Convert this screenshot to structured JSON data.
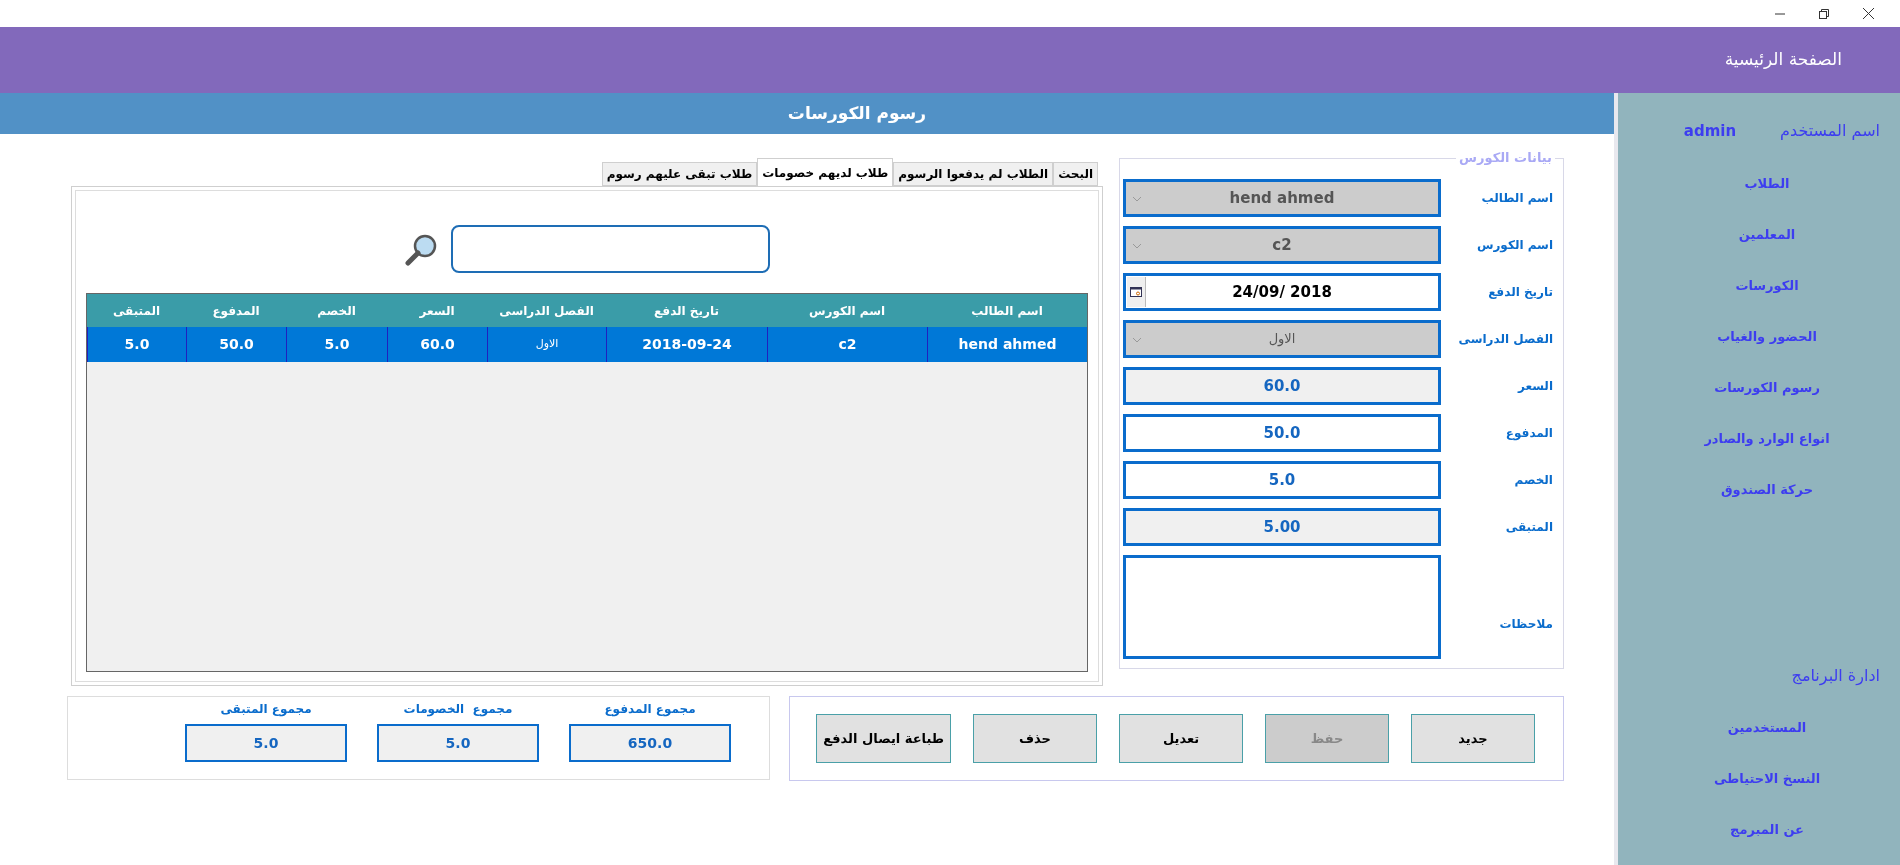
{
  "header": {
    "title": "الصفحة الرئيسية"
  },
  "page_title": "رسوم الكورسات",
  "tabs": [
    {
      "label": "البحث",
      "selected": false
    },
    {
      "label": "الطلاب لم يدفعوا الرسوم",
      "selected": false
    },
    {
      "label": "طلاب لديهم خصومات",
      "selected": true
    },
    {
      "label": "طلاب تبقى عليهم رسوم",
      "selected": false
    }
  ],
  "table": {
    "columns": [
      "اسم الطالب",
      "اسم الكورس",
      "تاريخ الدفع",
      "الفصل الدراسى",
      "السعر",
      "الخصم",
      "المدفوع",
      "المتبقى"
    ],
    "rows": [
      {
        "selected": true,
        "cells": [
          "hend ahmed",
          "c2",
          "2018-09-24",
          "الاول",
          "60.0",
          "5.0",
          "50.0",
          "5.0"
        ]
      }
    ]
  },
  "form": {
    "legend": "بيانات الكورس",
    "fields": [
      {
        "label": "اسم الطالب",
        "kind": "combo",
        "value": "hend ahmed",
        "disabled": true
      },
      {
        "label": "اسم الكورس",
        "kind": "combo",
        "value": "c2",
        "disabled": true
      },
      {
        "label": "تاريخ الدفع",
        "kind": "date",
        "value": "24/09/ 2018",
        "disabled": false
      },
      {
        "label": "الفصل الدراسى",
        "kind": "combo",
        "value": "الاول",
        "disabled": true
      },
      {
        "label": "السعر",
        "kind": "text",
        "value": "60.0",
        "disabled": true
      },
      {
        "label": "المدفوع",
        "kind": "text",
        "value": "50.0",
        "disabled": false
      },
      {
        "label": "الخصم",
        "kind": "text",
        "value": "5.0",
        "disabled": false
      },
      {
        "label": "المتبقى",
        "kind": "text",
        "value": "5.00",
        "disabled": true
      },
      {
        "label": "ملاحظات",
        "kind": "memo",
        "disabled": false
      }
    ]
  },
  "totals": [
    {
      "label": "مجموع المدفوع",
      "value": "650.0"
    },
    {
      "label": "مجموع  الخصومات",
      "value": "5.0"
    },
    {
      "label": "مجموع المتبقى",
      "value": "5.0"
    }
  ],
  "buttons": [
    {
      "label": "جديد",
      "disabled": false
    },
    {
      "label": "حفظ",
      "disabled": true
    },
    {
      "label": "تعديل",
      "disabled": false
    },
    {
      "label": "حذف",
      "disabled": false
    },
    {
      "label": "طباعة ايصال الدفع",
      "disabled": false
    }
  ],
  "sidebar": {
    "user_label": "اسم المستخدم",
    "user_name": "admin",
    "items": [
      "الطلاب",
      "المعلمين",
      "الكورسات",
      "الحضور والغياب",
      "رسوم الكورسات",
      "انواع الوارد والصادر",
      "حركة الصندوق"
    ],
    "admin_heading": "ادارة البرنامج",
    "admin_items": [
      "المستخدمين",
      "النسخ الاحتياطى",
      "عن المبرمج"
    ]
  }
}
